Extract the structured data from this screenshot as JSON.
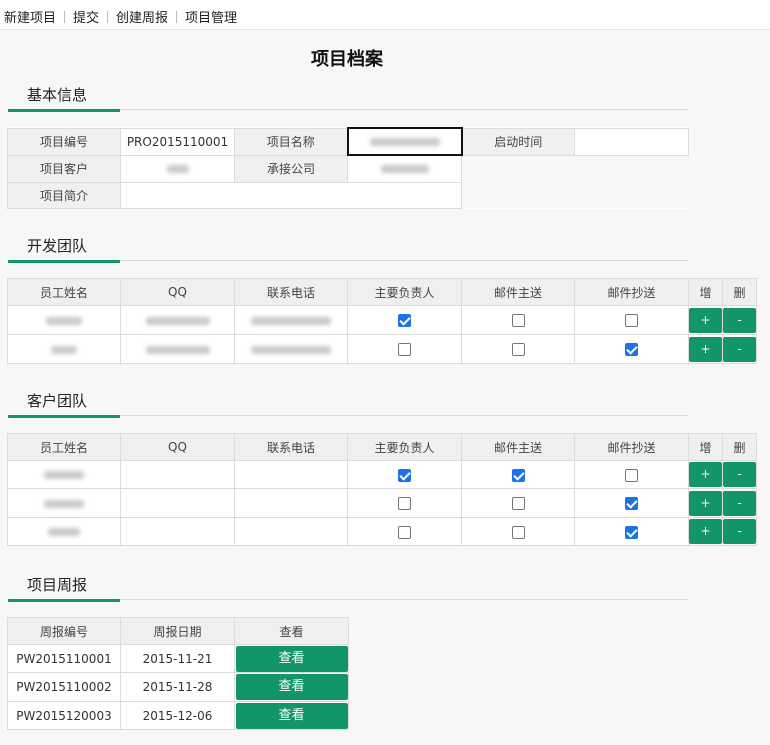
{
  "menu": [
    "新建项目",
    "提交",
    "创建周报",
    "项目管理"
  ],
  "page_title": "项目档案",
  "basic": {
    "section_title": "基本信息",
    "labels": {
      "code": "项目编号",
      "name": "项目名称",
      "start": "启动时间",
      "client": "项目客户",
      "contractor": "承接公司",
      "intro": "项目简介"
    },
    "values": {
      "code": "PRO2015110001",
      "start": "",
      "intro": ""
    }
  },
  "dev_team": {
    "section_title": "开发团队",
    "headers": [
      "员工姓名",
      "QQ",
      "联系电话",
      "主要负责人",
      "邮件主送",
      "邮件抄送",
      "增",
      "删"
    ],
    "rows": [
      {
        "principal": true,
        "mail_to": false,
        "mail_cc": false
      },
      {
        "principal": false,
        "mail_to": false,
        "mail_cc": true
      }
    ]
  },
  "client_team": {
    "section_title": "客户团队",
    "headers": [
      "员工姓名",
      "QQ",
      "联系电话",
      "主要负责人",
      "邮件主送",
      "邮件抄送",
      "增",
      "删"
    ],
    "rows": [
      {
        "principal": true,
        "mail_to": true,
        "mail_cc": false
      },
      {
        "principal": false,
        "mail_to": false,
        "mail_cc": true
      },
      {
        "principal": false,
        "mail_to": false,
        "mail_cc": true
      }
    ]
  },
  "weekly": {
    "section_title": "项目周报",
    "headers": [
      "周报编号",
      "周报日期",
      "查看"
    ],
    "rows": [
      {
        "code": "PW2015110001",
        "date": "2015-11-21",
        "action": "查看"
      },
      {
        "code": "PW2015110002",
        "date": "2015-11-28",
        "action": "查看"
      },
      {
        "code": "PW2015120003",
        "date": "2015-12-06",
        "action": "查看"
      }
    ]
  },
  "buttons": {
    "add": "+",
    "del": "-"
  },
  "colors": {
    "accent": "#12956a",
    "checkbox": "#1b73e8"
  }
}
